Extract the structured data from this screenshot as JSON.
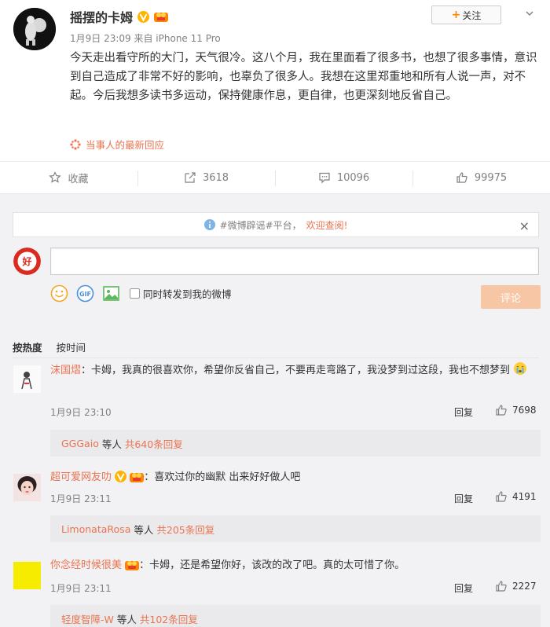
{
  "post": {
    "author": "摇摆的卡姆",
    "meta": "1月9日 23:09 来自 iPhone 11 Pro",
    "follow_label": "关注",
    "follow_plus": "+",
    "body": "今天走出看守所的大门，天气很冷。这八个月，我在里面看了很多书，也想了很多事情，意识到自己造成了非常不好的影响，也辜负了很多人。我想在这里郑重地和所有人说一声，对不起。今后我想多读书多运动，保持健康作息，更自律，也更深刻地反省自己。",
    "latest_response": "当事人的最新回应"
  },
  "actions": [
    {
      "icon": "star-icon",
      "label": "收藏"
    },
    {
      "icon": "share-icon",
      "label": "3618"
    },
    {
      "icon": "comment-icon",
      "label": "10096"
    },
    {
      "icon": "like-icon",
      "label": "99975"
    }
  ],
  "rumor": {
    "text": "#微博辟谣#平台，",
    "welcome": "欢迎查阅!",
    "close": "×"
  },
  "composer": {
    "placeholder": "",
    "sync_label": "同时转发到我的微博",
    "submit_label": "评论"
  },
  "sort_tabs": {
    "hot": "按热度",
    "time": "按时间"
  },
  "comments": [
    {
      "user": "沫国熠",
      "text": "：卡姆，我真的很喜欢你，希望你反省自己，不要再走弯路了，我没梦到过这段，我也不想梦到",
      "time": "1月9日 23:10",
      "reply": "回复",
      "likes": "7698",
      "sub_user": "GGGaio",
      "sub_mid": "等人",
      "sub_count": "共640条回复"
    },
    {
      "user": "超可爱网友叻",
      "text": "：喜欢过你的幽默  出来好好做人吧",
      "time": "1月9日 23:11",
      "reply": "回复",
      "likes": "4191",
      "sub_user": "LimonataRosa",
      "sub_mid": "等人",
      "sub_count": "共205条回复"
    },
    {
      "user": "你念经时候很美",
      "text": "：卡姆，还是希望你好，该改的改了吧。真的太可惜了你。",
      "time": "1月9日 23:11",
      "reply": "回复",
      "likes": "2227",
      "sub_user": "轻度智障-W",
      "sub_mid": "等人",
      "sub_count": "共102条回复"
    }
  ],
  "colors": {
    "accent": "#eb7350",
    "follow_plus": "#ff8200",
    "comment_bg": "#f2f2f5",
    "submit_disabled": "#f7c6a5"
  }
}
